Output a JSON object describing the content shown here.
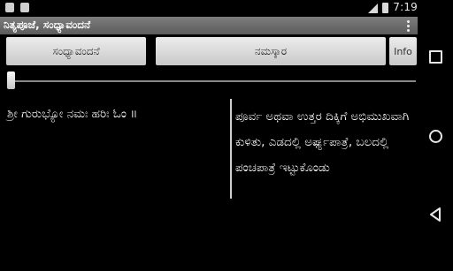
{
  "status_bar": {
    "time": "7:19",
    "left_icons": [
      "notification-icon",
      "android-icon"
    ],
    "right_icons": [
      "signal-icon",
      "battery-icon"
    ]
  },
  "action_bar": {
    "title": "ನಿತ್ಯಪೂಜೆ, ಸಂಧ್ಯಾವಂದನೆ",
    "menu_icon": "overflow-menu-icon"
  },
  "buttons": {
    "sandhya_label": "ಸಂಧ್ಯಾವಂದನೆ",
    "namaskara_label": "ನಮಸ್ಕಾರ",
    "info_label": "Info"
  },
  "slider": {
    "value": 0
  },
  "content": {
    "mantra": "ಶ್ರೀ ಗುರುಭ್ಯೋ ನಮಃ ಹರಿಃ ಓಂ ॥",
    "instruction": "ಪೂರ್ವ ಅಥವಾ ಉತ್ತರ ದಿಕ್ಕಿಗೆ ಅಭಿಮುಖವಾಗಿ ಕುಳಿತು, ಎಡದಲ್ಲಿ ಅರ್ಘ್ಯಪಾತ್ರೆ, ಬಲದಲ್ಲಿ ಪಂಚಪಾತ್ರೆ ಇಟ್ಟುಕೊಂಡು"
  },
  "nav_bar": {
    "buttons": [
      "recents-icon",
      "home-icon",
      "back-icon"
    ]
  },
  "colors": {
    "background": "#000000",
    "action_bar": "#6b6b6b",
    "button": "#dcdcdc",
    "text": "#ffffff"
  }
}
